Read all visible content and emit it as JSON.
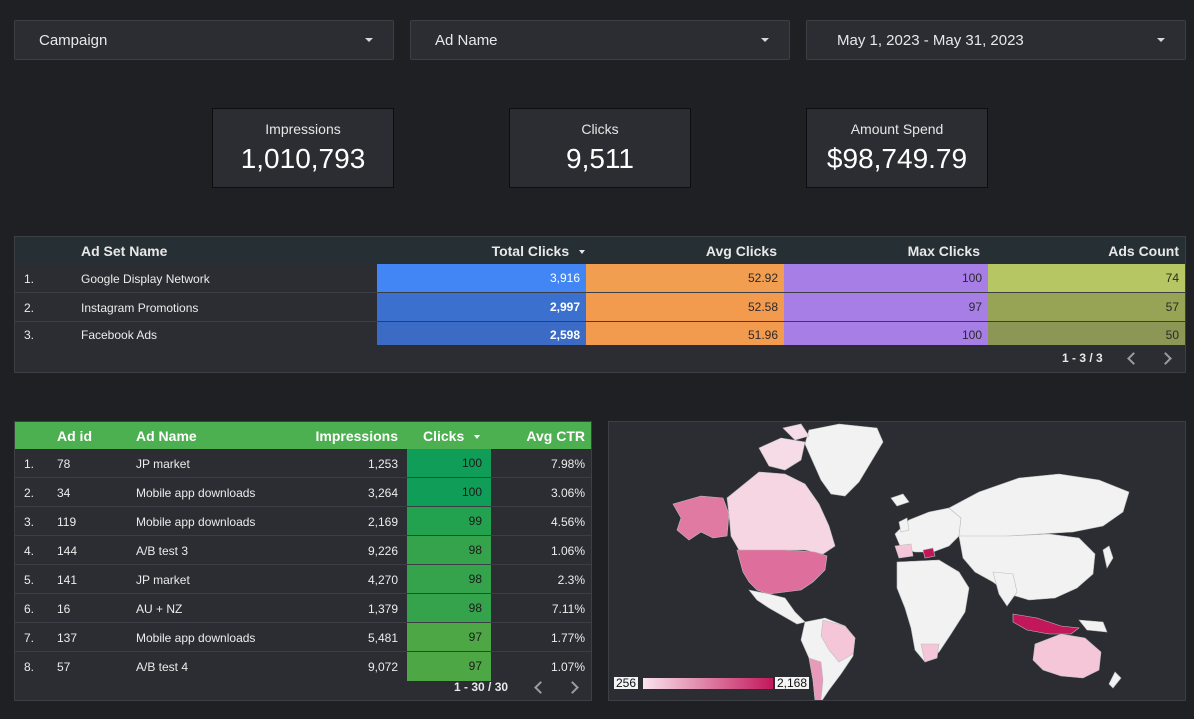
{
  "filters": {
    "campaign": "Campaign",
    "ad_name": "Ad Name",
    "date_range": "May 1, 2023 - May 31, 2023"
  },
  "kpis": {
    "impressions_label": "Impressions",
    "impressions_value": "1,010,793",
    "clicks_label": "Clicks",
    "clicks_value": "9,511",
    "spend_label": "Amount Spend",
    "spend_value": "$98,749.79"
  },
  "adset_table": {
    "headers": {
      "name": "Ad Set Name",
      "total_clicks": "Total Clicks",
      "avg_clicks": "Avg Clicks",
      "max_clicks": "Max Clicks",
      "ads_count": "Ads Count"
    },
    "rows": [
      {
        "num": "1.",
        "name": "Google Display Network",
        "total_clicks": "3,916",
        "avg_clicks": "52.92",
        "max_clicks": "100",
        "ads_count": "74"
      },
      {
        "num": "2.",
        "name": "Instagram Promotions",
        "total_clicks": "2,997",
        "avg_clicks": "52.58",
        "max_clicks": "97",
        "ads_count": "57"
      },
      {
        "num": "3.",
        "name": "Facebook Ads",
        "total_clicks": "2,598",
        "avg_clicks": "51.96",
        "max_clicks": "100",
        "ads_count": "50"
      }
    ],
    "pagination": "1 - 3 / 3",
    "colors": {
      "total_clicks": [
        "#4285f4",
        "#3b70cf",
        "#3b6bc4"
      ],
      "avg_clicks": [
        "#f29e50",
        "#f29a4e",
        "#f29a4e"
      ],
      "max_clicks": [
        "#a77de6",
        "#a77de6",
        "#a77de6"
      ],
      "ads_count": [
        "#b5c662",
        "#97a455",
        "#8c9655"
      ]
    }
  },
  "ads_table": {
    "headers": {
      "id": "Ad id",
      "name": "Ad Name",
      "impressions": "Impressions",
      "clicks": "Clicks",
      "avg_ctr": "Avg CTR"
    },
    "rows": [
      {
        "num": "1.",
        "id": "78",
        "name": "JP market",
        "impressions": "1,253",
        "clicks": "100",
        "avg_ctr": "7.98%"
      },
      {
        "num": "2.",
        "id": "34",
        "name": "Mobile app downloads",
        "impressions": "3,264",
        "clicks": "100",
        "avg_ctr": "3.06%"
      },
      {
        "num": "3.",
        "id": "119",
        "name": "Mobile app downloads",
        "impressions": "2,169",
        "clicks": "99",
        "avg_ctr": "4.56%"
      },
      {
        "num": "4.",
        "id": "144",
        "name": "A/B test 3",
        "impressions": "9,226",
        "clicks": "98",
        "avg_ctr": "1.06%"
      },
      {
        "num": "5.",
        "id": "141",
        "name": "JP market",
        "impressions": "4,270",
        "clicks": "98",
        "avg_ctr": "2.3%"
      },
      {
        "num": "6.",
        "id": "16",
        "name": "AU + NZ",
        "impressions": "1,379",
        "clicks": "98",
        "avg_ctr": "7.11%"
      },
      {
        "num": "7.",
        "id": "137",
        "name": "Mobile app downloads",
        "impressions": "5,481",
        "clicks": "97",
        "avg_ctr": "1.77%"
      },
      {
        "num": "8.",
        "id": "57",
        "name": "A/B test 4",
        "impressions": "9,072",
        "clicks": "97",
        "avg_ctr": "1.07%"
      }
    ],
    "clicks_colors": [
      "#0f9d58",
      "#0f9d58",
      "#22a14f",
      "#34a34b",
      "#34a34b",
      "#34a34b",
      "#4ea745",
      "#4ea745"
    ],
    "pagination": "1 - 30 / 30"
  },
  "geo_map": {
    "legend_min": "256",
    "legend_max": "2,168",
    "legend_colors": [
      "#fae3ec",
      "#c2185b"
    ]
  }
}
